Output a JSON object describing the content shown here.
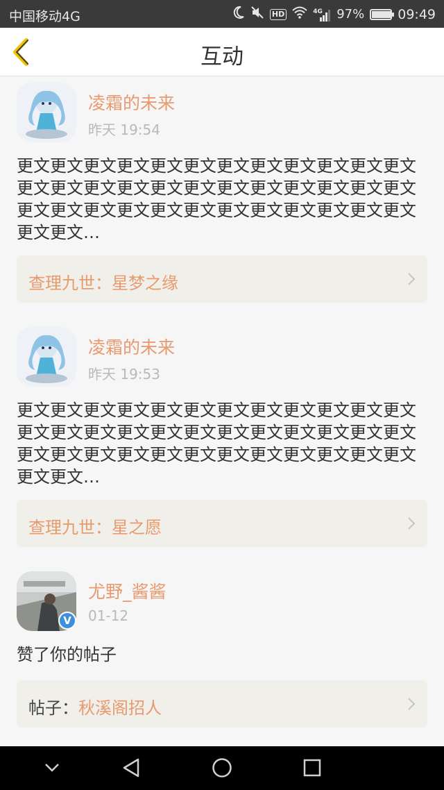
{
  "status_bar": {
    "carrier": "中国移动4G",
    "network_badge": "4G",
    "hd_badge": "HD",
    "battery": "97%",
    "battery_level": 0.97,
    "time": "09:49"
  },
  "header": {
    "title": "互动",
    "back_icon": "chevron-left-icon"
  },
  "feed": {
    "items": [
      {
        "name": "凌霜的未来",
        "time": "昨天 19:54",
        "content": "更文更文更文更文更文更文更文更文更文更文更文更文更文更文更文更文更文更文更文更文更文更文更文更文更文更文更文更文更文更文更文更文更文更文更文更文更文更文…",
        "ref_prefix": "",
        "ref_text": "查理九世：星梦之缘"
      },
      {
        "name": "凌霜的未来",
        "time": "昨天 19:53",
        "content": "更文更文更文更文更文更文更文更文更文更文更文更文更文更文更文更文更文更文更文更文更文更文更文更文更文更文更文更文更文更文更文更文更文更文更文更文更文更文…",
        "ref_prefix": "",
        "ref_text": "查理九世：星之愿"
      },
      {
        "name": "尤野_酱酱",
        "time": "01-12",
        "content": "赞了你的帖子",
        "verified": "V",
        "ref_prefix": "帖子：",
        "ref_text": "秋溪阁招人"
      }
    ]
  },
  "colors": {
    "accent": "#e89a6f",
    "status_bar": "#3a3a3a",
    "background": "#f7f6f6",
    "ref_background": "#f0efe9",
    "verified": "#3e90db"
  }
}
